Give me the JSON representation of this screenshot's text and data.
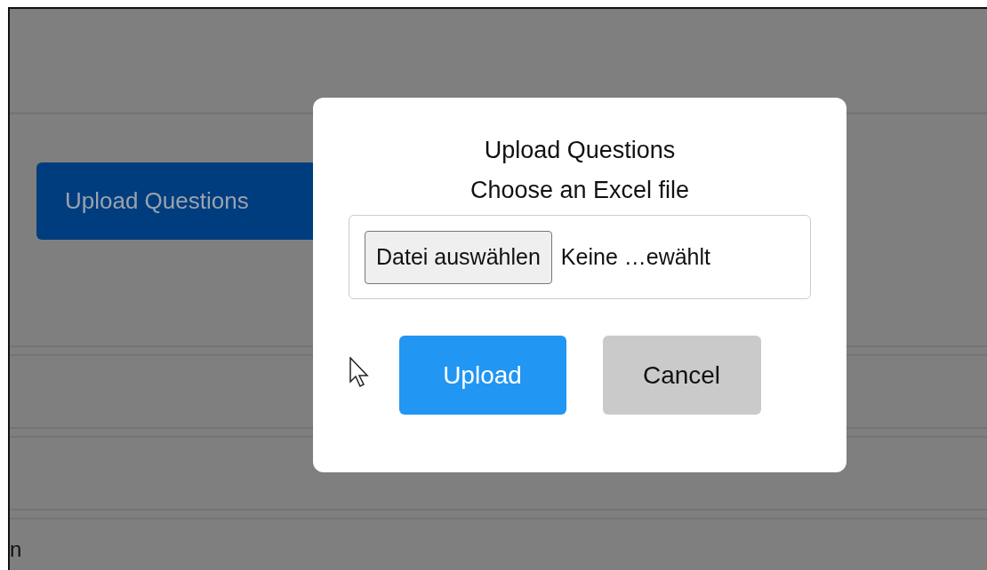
{
  "page": {
    "action_button": "Upload Questions",
    "partial_text": "n"
  },
  "dialog": {
    "title": "Upload Questions",
    "prompt": "Choose an Excel file",
    "file_input": {
      "button": "Datei auswählen",
      "status": "Keine …ewählt"
    },
    "buttons": [
      {
        "label": "Upload",
        "kind": "primary"
      },
      {
        "label": "Cancel",
        "kind": "secondary"
      }
    ]
  }
}
